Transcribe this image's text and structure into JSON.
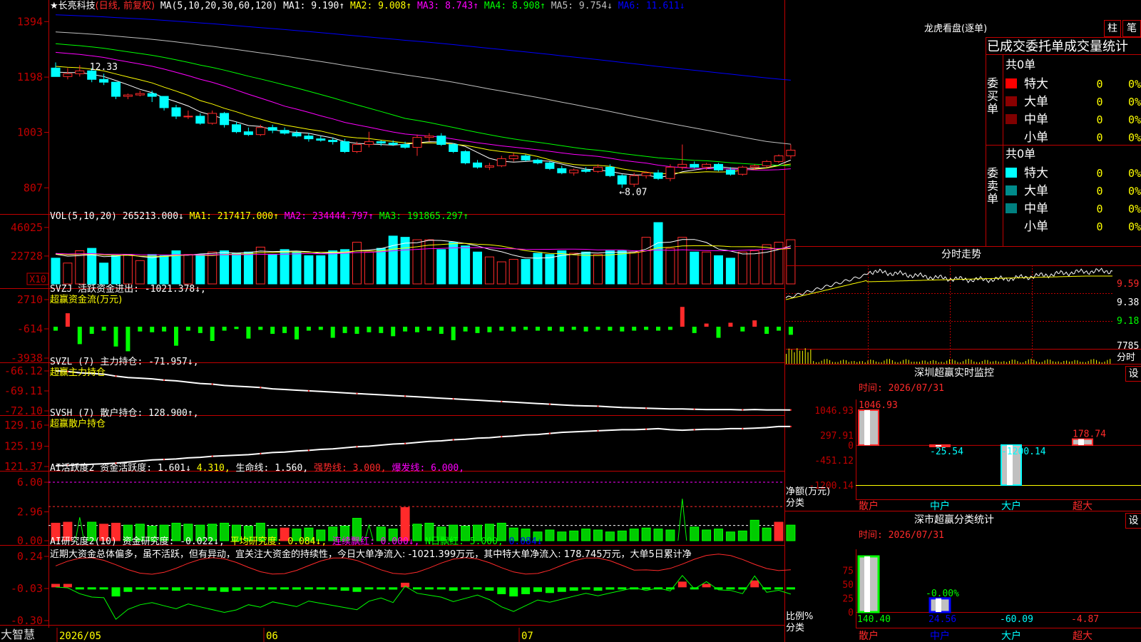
{
  "colors": {
    "up": "#ff2a2a",
    "down": "#00ffff",
    "ma1": "#ffffff",
    "ma2": "#ffff00",
    "ma3": "#ff00ff",
    "ma4": "#00ff00",
    "ma5": "#bfbfbf",
    "ma6": "#0000ff",
    "axis": "#c00000",
    "gain": "#ff2a2a",
    "loss": "#00ff00"
  },
  "header": {
    "stock": "★长亮科技",
    "period": "(日线, 前复权)",
    "ma_params": "MA(5,10,20,30,60,120)",
    "ma1": "MA1: 9.190↑",
    "ma2": "MA2: 9.008↑",
    "ma3": "MA3: 8.743↑",
    "ma4": "MA4: 8.908↑",
    "ma5": "MA5: 9.754↓",
    "ma6": "MA6: 11.611↓"
  },
  "price_panel": {
    "ticks": [
      "1394",
      "1198",
      "1003",
      "807"
    ],
    "high_label": "12.33",
    "low_label": "←8.07"
  },
  "vol_panel": {
    "legend": "VOL(5,10,20)",
    "value": "265213.000↓",
    "ma1": "MA1: 217417.000↑",
    "ma2": "MA2: 234444.797↑",
    "ma3": "MA3: 191865.297↑",
    "ticks": [
      "46025",
      "22728"
    ],
    "unit": "X10"
  },
  "svzj_panel": {
    "legend": "SVZJ  活跃资金进出: -1021.378↓,",
    "subtitle": "超赢资金流(万元)",
    "ticks": [
      "2710",
      "-614",
      "-3938"
    ]
  },
  "svzl_panel": {
    "legend": "SVZL (7) 主力持仓: -71.957↓,",
    "subtitle": "超赢主力持仓",
    "ticks": [
      "-66.12",
      "-69.11",
      "-72.10"
    ]
  },
  "svsh_panel": {
    "legend": "SVSH (7) 散户持仓: 128.900↑,",
    "subtitle": "超赢散户持仓",
    "ticks": [
      "129.16",
      "125.19",
      "121.37"
    ]
  },
  "ai1_panel": {
    "legend": "AI活跃度2 资金活跃度: 1.601↓",
    "v2": "4.310,",
    "v3": "生命线: 1.560,",
    "v4": "强势线: 3.000,",
    "v5": "爆发线: 6.000,",
    "ticks": [
      "6.00",
      "2.96",
      "0.00"
    ]
  },
  "ai2_panel": {
    "legend": "AI研究度2(10) 资金研究度: -0.022↓,",
    "v2": "平均研究度: 0.084↓,",
    "v3": "连续飘红: 0.000↓,",
    "v4": "N日飘红: 5.000,",
    "v5": "0.084↓",
    "ticks": [
      "0.24",
      "-0.03",
      "-0.30"
    ],
    "comment": "近期大资金总体偏多，虽不活跃，但有异动，宜关注大资金的持续性，今日大单净流入: -1021.399万元，其中特大单净流入: 178.745万元，大单5日累计净"
  },
  "date_axis": [
    "2026/05",
    "06",
    "07"
  ],
  "app_name": "大智慧",
  "right": {
    "title": "龙虎看盘(逐单)",
    "btn1": "柱",
    "btn2": "笔",
    "subtitle": "已成交委托单成交量统计",
    "buy": {
      "label": "委买单",
      "total": "共0单",
      "rows": [
        {
          "name": "特大",
          "count": "0",
          "pct": "0%",
          "color": "#ff0000"
        },
        {
          "name": "大单",
          "count": "0",
          "pct": "0%",
          "color": "#8b0000"
        },
        {
          "name": "中单",
          "count": "0",
          "pct": "0%",
          "color": "#800000"
        },
        {
          "name": "小单",
          "count": "0",
          "pct": "0%",
          "color": "#000000"
        }
      ]
    },
    "sell": {
      "label": "委卖单",
      "total": "共0单",
      "rows": [
        {
          "name": "特大",
          "count": "0",
          "pct": "0%",
          "color": "#00ffff"
        },
        {
          "name": "大单",
          "count": "0",
          "pct": "0%",
          "color": "#008b8b"
        },
        {
          "name": "中单",
          "count": "0",
          "pct": "0%",
          "color": "#008080"
        },
        {
          "name": "小单",
          "count": "0",
          "pct": "0%",
          "color": "#000000"
        }
      ]
    },
    "intraday": {
      "title": "分时走势",
      "ticks": [
        "9.59",
        "9.38",
        "9.18"
      ],
      "vol_tick": "7785",
      "vol_label": "分时"
    },
    "monitor": {
      "title": "深圳超赢实时监控",
      "btn": "设",
      "time": "时间: 2026/07/31",
      "ylabel": "净额(万元)",
      "xlabel": "分类",
      "ticks": [
        "1046.93",
        "297.91",
        "0",
        "-451.12",
        "-1200.14"
      ],
      "categories": [
        "散户",
        "中户",
        "大户",
        "超大"
      ],
      "values": [
        1046.93,
        -25.54,
        -1200.14,
        178.74
      ],
      "labels": [
        "1046.93",
        "-25.54",
        "-1200.14",
        "178.74"
      ]
    },
    "classify": {
      "title": "深市超赢分类统计",
      "btn": "设",
      "time": "时间: 2026/07/31",
      "ylabel": "比例%",
      "xlabel": "分类",
      "ticks": [
        "75",
        "50",
        "25",
        "0"
      ],
      "categories": [
        "散户",
        "中户",
        "大户",
        "超大"
      ],
      "values": [
        140.4,
        24.56,
        -60.09,
        -4.87
      ],
      "labels": [
        "140.40",
        "24.56",
        "-60.09",
        "-4.87"
      ],
      "mid_label": "-0.00%"
    }
  },
  "chart_data": [
    {
      "type": "candlestick",
      "title": "长亮科技 日线 前复权",
      "ylim": [
        7.7,
        14.3
      ],
      "ohlc": [
        [
          12.3,
          12.5,
          12.1,
          12.0
        ],
        [
          12.0,
          12.3,
          11.9,
          12.1
        ],
        [
          12.1,
          12.4,
          12.0,
          12.2
        ],
        [
          12.2,
          12.3,
          11.8,
          11.9
        ],
        [
          11.9,
          12.1,
          11.7,
          11.8
        ],
        [
          11.8,
          11.8,
          11.2,
          11.3
        ],
        [
          11.3,
          11.4,
          11.2,
          11.35
        ],
        [
          11.35,
          11.5,
          11.3,
          11.4
        ],
        [
          11.4,
          11.5,
          11.1,
          11.3
        ],
        [
          11.3,
          11.3,
          10.8,
          10.9
        ],
        [
          10.9,
          11.0,
          10.5,
          10.6
        ],
        [
          10.6,
          10.8,
          10.5,
          10.6
        ],
        [
          10.6,
          10.7,
          10.3,
          10.35
        ],
        [
          10.35,
          10.8,
          10.3,
          10.7
        ],
        [
          10.7,
          10.75,
          10.2,
          10.3
        ],
        [
          10.3,
          10.4,
          10.0,
          10.05
        ],
        [
          10.05,
          10.2,
          9.9,
          9.95
        ],
        [
          9.95,
          10.3,
          9.9,
          10.2
        ],
        [
          10.2,
          10.3,
          10.0,
          10.1
        ],
        [
          10.1,
          10.2,
          9.95,
          10.0
        ],
        [
          10.0,
          10.1,
          9.85,
          9.9
        ],
        [
          9.9,
          10.0,
          9.7,
          9.8
        ],
        [
          9.8,
          9.9,
          9.7,
          9.75
        ],
        [
          9.75,
          9.85,
          9.6,
          9.7
        ],
        [
          9.7,
          9.8,
          9.3,
          9.35
        ],
        [
          9.35,
          9.7,
          9.3,
          9.6
        ],
        [
          9.6,
          10.05,
          9.5,
          9.7
        ],
        [
          9.7,
          9.75,
          9.55,
          9.65
        ],
        [
          9.65,
          9.75,
          9.55,
          9.6
        ],
        [
          9.6,
          9.7,
          9.45,
          9.5
        ],
        [
          9.5,
          9.95,
          9.2,
          9.85
        ],
        [
          9.85,
          10.0,
          9.7,
          9.9
        ],
        [
          9.9,
          10.0,
          9.55,
          9.6
        ],
        [
          9.6,
          9.65,
          9.3,
          9.35
        ],
        [
          9.35,
          9.4,
          8.9,
          8.95
        ],
        [
          8.95,
          9.05,
          8.75,
          8.8
        ],
        [
          8.8,
          8.95,
          8.7,
          8.85
        ],
        [
          8.85,
          9.2,
          8.8,
          9.1
        ],
        [
          9.1,
          9.3,
          9.0,
          9.2
        ],
        [
          9.2,
          9.25,
          9.0,
          9.05
        ],
        [
          9.05,
          9.1,
          8.9,
          8.95
        ],
        [
          8.95,
          9.0,
          8.7,
          8.75
        ],
        [
          8.75,
          8.85,
          8.55,
          8.6
        ],
        [
          8.6,
          8.75,
          8.5,
          8.7
        ],
        [
          8.7,
          8.8,
          8.6,
          8.65
        ],
        [
          8.65,
          8.9,
          8.6,
          8.8
        ],
        [
          8.8,
          8.9,
          8.45,
          8.5
        ],
        [
          8.5,
          8.55,
          8.07,
          8.2
        ],
        [
          8.2,
          8.6,
          8.1,
          8.5
        ],
        [
          8.5,
          8.65,
          8.4,
          8.6
        ],
        [
          8.6,
          8.7,
          8.35,
          8.4
        ],
        [
          8.4,
          8.9,
          8.3,
          8.8
        ],
        [
          8.8,
          9.6,
          8.7,
          8.9
        ],
        [
          8.9,
          9.0,
          8.75,
          8.8
        ],
        [
          8.8,
          8.95,
          8.7,
          8.9
        ],
        [
          8.9,
          8.95,
          8.65,
          8.7
        ],
        [
          8.7,
          8.8,
          8.5,
          8.55
        ],
        [
          8.55,
          8.85,
          8.5,
          8.8
        ],
        [
          8.8,
          8.9,
          8.7,
          8.85
        ],
        [
          8.85,
          9.05,
          8.8,
          9.0
        ],
        [
          9.0,
          9.25,
          8.95,
          9.2
        ],
        [
          9.2,
          9.6,
          9.1,
          9.4
        ]
      ]
    },
    {
      "type": "bar",
      "title": "VOL",
      "ylim": [
        0,
        5000
      ],
      "values": [
        2100,
        1700,
        2700,
        2900,
        1700,
        2300,
        2400,
        1900,
        2400,
        2300,
        2700,
        2400,
        2400,
        2600,
        2700,
        2500,
        2600,
        3000,
        2400,
        2800,
        2600,
        2300,
        2300,
        2700,
        2800,
        3400,
        2600,
        2900,
        3900,
        3800,
        3600,
        3600,
        2800,
        3400,
        3100,
        2600,
        2200,
        1800,
        2000,
        2000,
        2500,
        2400,
        2700,
        2500,
        2600,
        2400,
        2700,
        2700,
        2600,
        3800,
        5000,
        2900,
        3800,
        2600,
        2600,
        2300,
        2100,
        2600,
        2700,
        3200,
        3400,
        3600
      ]
    },
    {
      "type": "bar",
      "title": "超赢资金流(万元)",
      "ylim": [
        -3938,
        2710
      ],
      "values": [
        -500,
        1700,
        -2200,
        -900,
        -500,
        -2500,
        -3100,
        -600,
        -700,
        -600,
        -2400,
        -500,
        -800,
        -1800,
        -500,
        -300,
        -1500,
        -400,
        -900,
        -800,
        -1600,
        -500,
        -400,
        -1400,
        -800,
        -900,
        -700,
        -800,
        -1200,
        -600,
        -700,
        -500,
        -900,
        -1700,
        -600,
        -800,
        -700,
        -500,
        -600,
        -400,
        -500,
        -500,
        -600,
        -400,
        -600,
        -400,
        -500,
        -600,
        -500,
        -400,
        -500,
        -400,
        2500,
        -800,
        400,
        -1400,
        500,
        -600,
        800,
        -900,
        -500,
        -1021
      ]
    },
    {
      "type": "line",
      "title": "超赢主力持仓",
      "ylim": [
        -72.1,
        -66.12
      ],
      "values": [
        -66.1,
        -66.2,
        -66.4,
        -66.5,
        -66.6,
        -66.9,
        -67.1,
        -67.2,
        -67.3,
        -67.5,
        -67.6,
        -67.8,
        -68.0,
        -68.1,
        -68.3,
        -68.4,
        -68.5,
        -68.6,
        -68.8,
        -68.9,
        -69.0,
        -69.1,
        -69.2,
        -69.3,
        -69.4,
        -69.5,
        -69.6,
        -69.7,
        -69.8,
        -69.9,
        -70.0,
        -70.1,
        -70.2,
        -70.3,
        -70.4,
        -70.5,
        -70.6,
        -70.7,
        -70.8,
        -70.9,
        -71.0,
        -71.1,
        -71.2,
        -71.3,
        -71.35,
        -71.4,
        -71.5,
        -71.6,
        -71.65,
        -71.7,
        -71.75,
        -71.8,
        -71.8,
        -71.85,
        -71.9,
        -71.9,
        -71.9,
        -71.95,
        -71.9,
        -71.95,
        -71.95,
        -71.957
      ]
    },
    {
      "type": "line",
      "title": "超赢散户持仓",
      "ylim": [
        121.37,
        129.16
      ],
      "values": [
        121.5,
        121.6,
        121.7,
        121.8,
        121.9,
        122.0,
        122.2,
        122.4,
        122.6,
        122.7,
        122.8,
        123.0,
        123.1,
        123.3,
        123.4,
        123.5,
        123.6,
        123.8,
        124.0,
        124.1,
        124.3,
        124.4,
        124.6,
        124.7,
        124.9,
        125.1,
        125.2,
        125.4,
        125.6,
        125.7,
        125.9,
        126.1,
        126.2,
        126.4,
        126.5,
        126.7,
        126.8,
        127.0,
        127.1,
        127.3,
        127.4,
        127.6,
        127.8,
        127.9,
        128.0,
        128.1,
        128.2,
        128.3,
        128.3,
        128.4,
        128.5,
        128.3,
        128.2,
        128.3,
        128.4,
        128.4,
        128.5,
        128.5,
        128.6,
        128.7,
        128.9,
        128.9
      ]
    },
    {
      "type": "bar",
      "title": "AI活跃度2",
      "ylim": [
        0,
        6
      ],
      "lines": {
        "生命线": 1.56,
        "强势线": 3.0,
        "爆发线": 6.0
      },
      "values": [
        1.8,
        1.9,
        2.4,
        1.9,
        1.7,
        1.8,
        1.6,
        1.7,
        1.5,
        1.6,
        1.8,
        1.7,
        1.6,
        1.7,
        1.8,
        1.6,
        1.5,
        1.8,
        1.2,
        1.3,
        1.2,
        1.3,
        1.1,
        1.4,
        1.5,
        2.3,
        1.6,
        1.4,
        1.2,
        3.4,
        1.7,
        1.8,
        1.4,
        1.6,
        1.5,
        1.6,
        1.7,
        1.8,
        1.3,
        1.2,
        0.9,
        1.1,
        0.9,
        1.0,
        1.2,
        1.1,
        0.9,
        1.0,
        1.2,
        1.3,
        1.2,
        1.1,
        4.3,
        1.4,
        1.1,
        1.2,
        0.9,
        1.0,
        2.1,
        1.3,
        1.9,
        1.6
      ]
    },
    {
      "type": "bar",
      "title": "AI研究度2(10)",
      "ylim": [
        -0.3,
        0.24
      ],
      "values": [
        0.01,
        0.01,
        -0.01,
        -0.02,
        -0.02,
        -0.1,
        -0.06,
        -0.04,
        -0.03,
        -0.04,
        -0.05,
        -0.03,
        -0.04,
        -0.05,
        -0.06,
        -0.05,
        -0.03,
        -0.04,
        -0.02,
        -0.03,
        -0.04,
        -0.02,
        -0.03,
        -0.04,
        -0.05,
        -0.06,
        -0.03,
        -0.02,
        -0.04,
        0.02,
        -0.01,
        -0.02,
        -0.03,
        -0.05,
        -0.04,
        -0.03,
        -0.05,
        -0.08,
        -0.1,
        -0.08,
        -0.06,
        -0.07,
        -0.06,
        -0.05,
        -0.04,
        -0.05,
        -0.04,
        -0.03,
        -0.02,
        -0.03,
        -0.02,
        -0.03,
        0.03,
        -0.02,
        0.01,
        -0.02,
        -0.02,
        -0.03,
        0.04,
        -0.02,
        -0.01,
        -0.022
      ]
    }
  ]
}
